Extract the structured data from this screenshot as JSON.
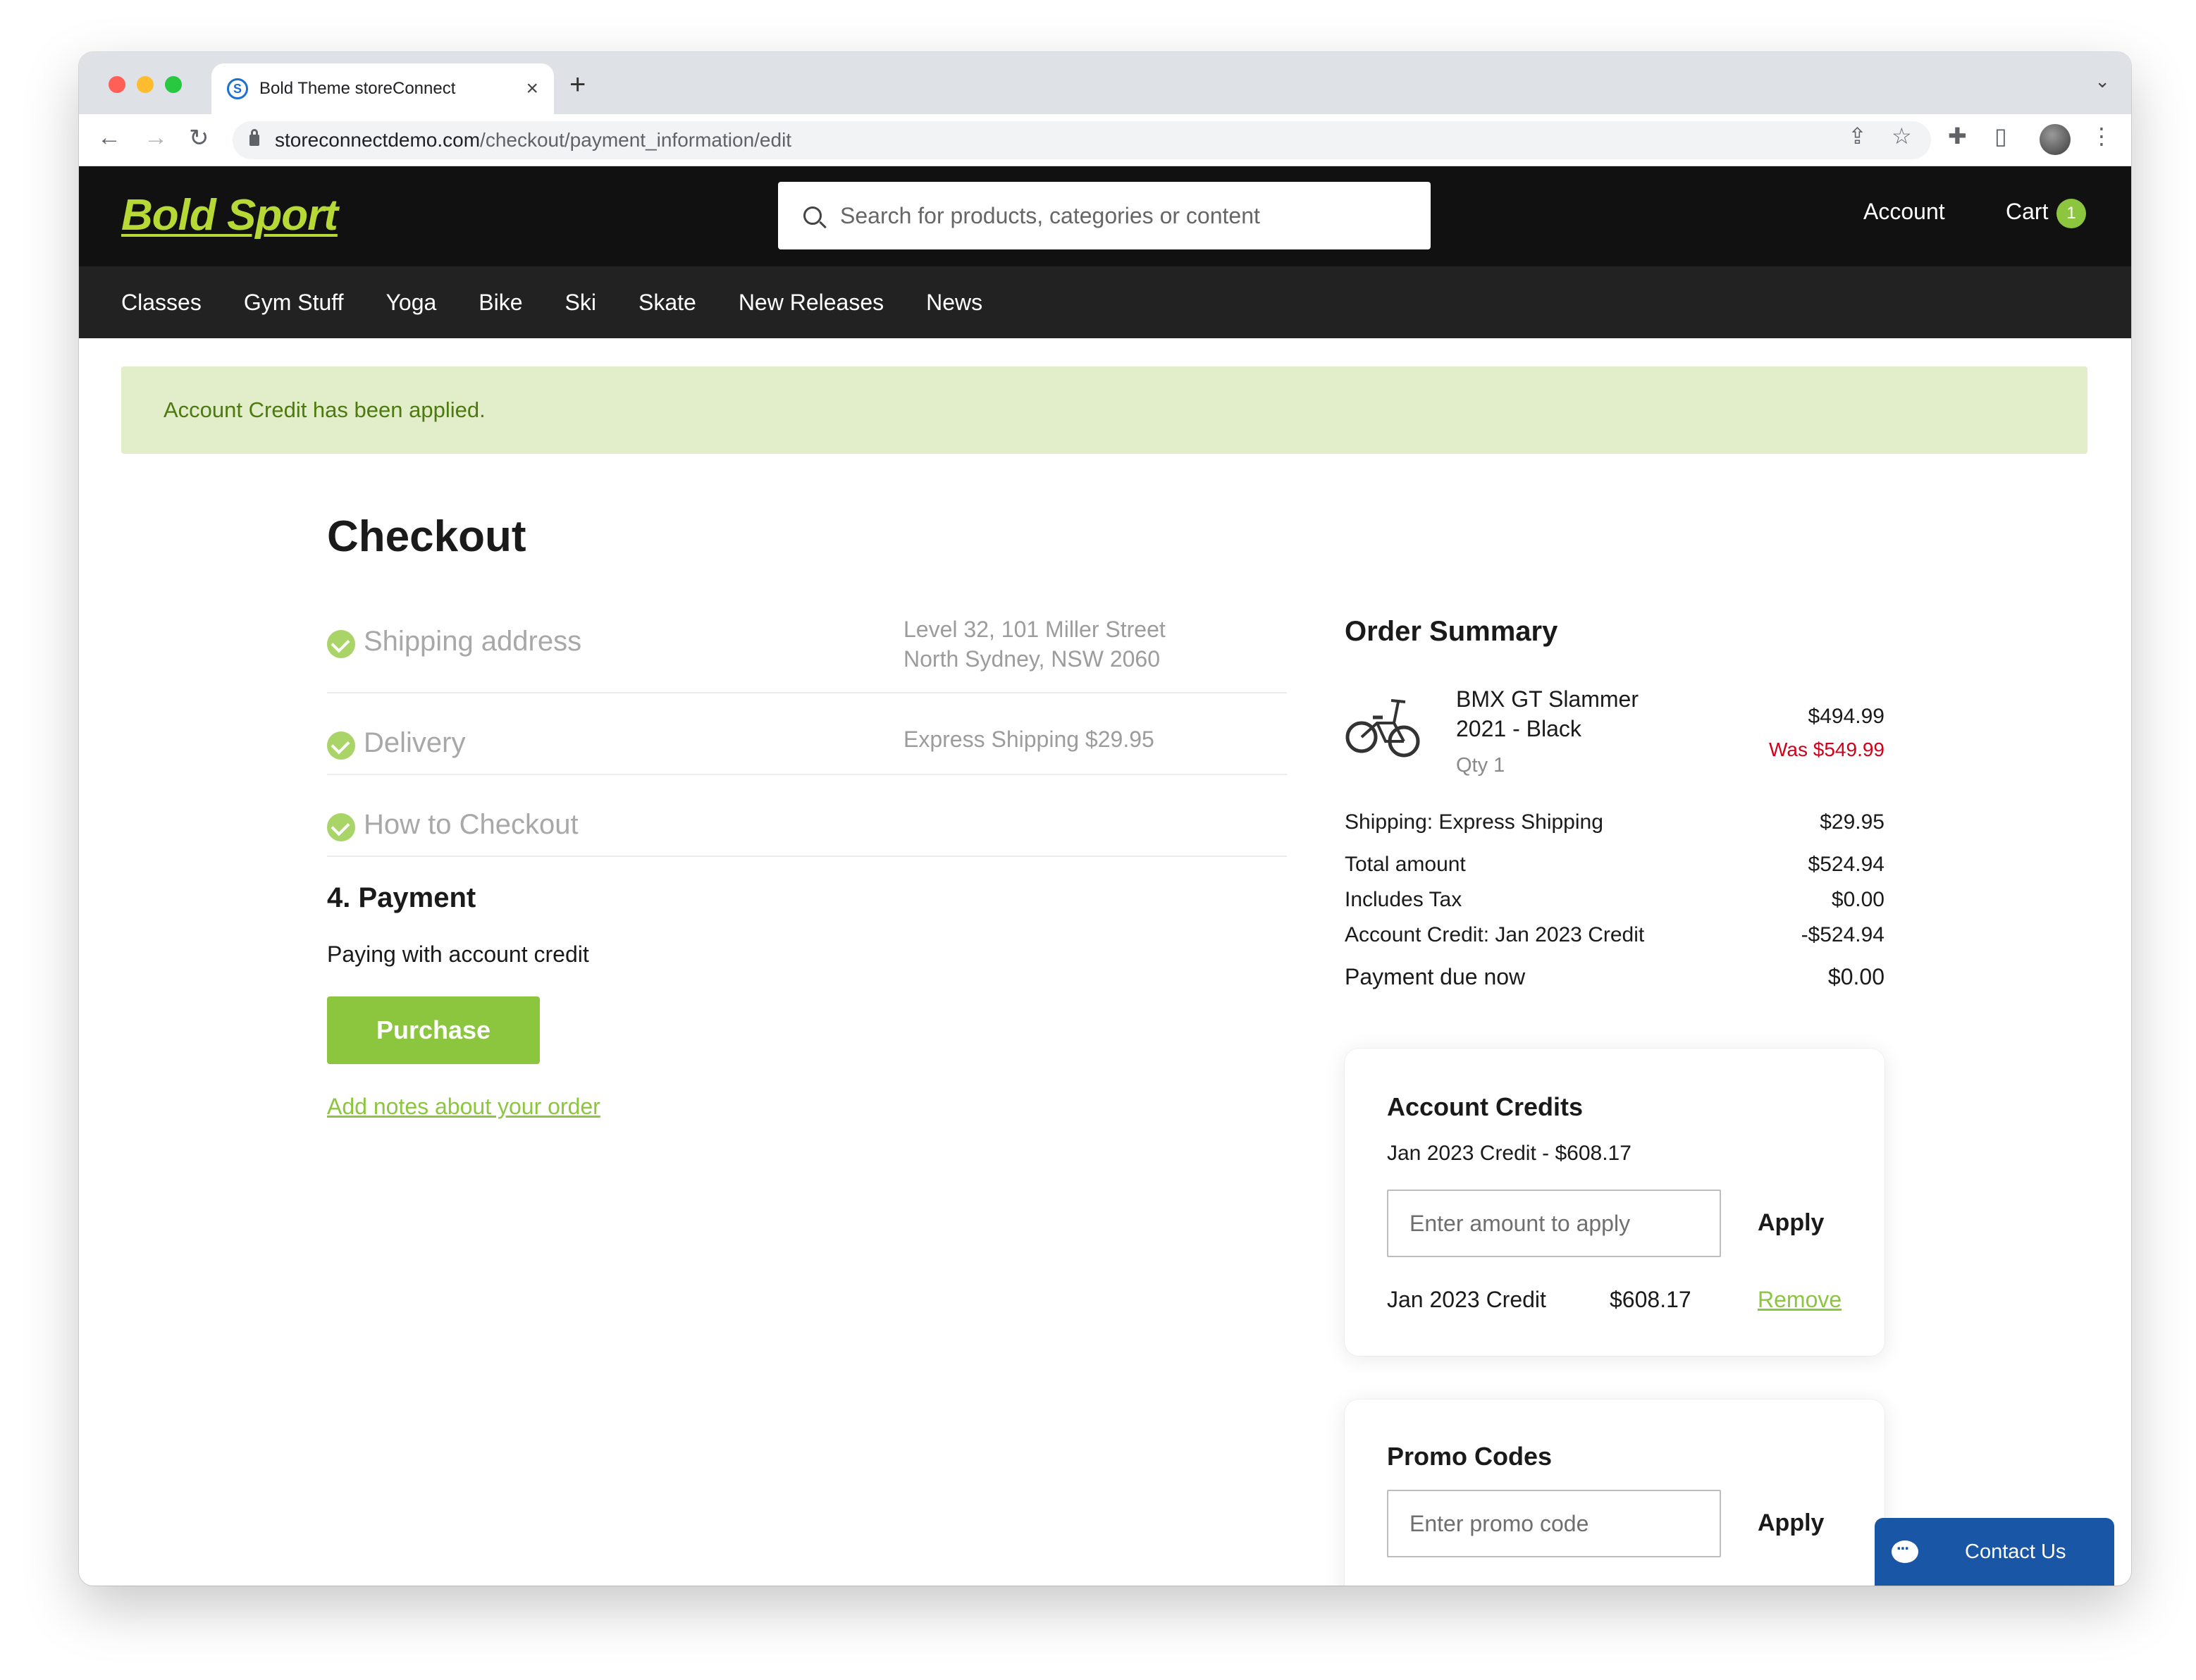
{
  "browser": {
    "tab_title": "Bold Theme storeConnect",
    "tab_close": "×",
    "new_tab": "+",
    "tab_menu": "⌄",
    "url_host": "storeconnectdemo.com",
    "url_path": "/checkout/payment_information/edit"
  },
  "site": {
    "logo": "Bold Sport",
    "search_placeholder": "Search for products, categories or content",
    "account_label": "Account",
    "cart_label": "Cart",
    "cart_count": "1",
    "nav": [
      "Classes",
      "Gym Stuff",
      "Yoga",
      "Bike",
      "Ski",
      "Skate",
      "New Releases",
      "News"
    ]
  },
  "alert": "Account Credit has been applied.",
  "checkout": {
    "title": "Checkout",
    "steps": [
      {
        "label": "Shipping address",
        "detail_line1": "Level 32, 101 Miller Street",
        "detail_line2": "North Sydney, NSW 2060"
      },
      {
        "label": "Delivery",
        "detail_line1": "Express Shipping $29.95"
      },
      {
        "label": "How to Checkout"
      }
    ],
    "payment_heading": "4. Payment",
    "payment_method": "Paying with account credit",
    "purchase_button": "Purchase",
    "notes_link": "Add notes about your order"
  },
  "order_summary": {
    "title": "Order Summary",
    "item": {
      "name_line1": "BMX GT Slammer",
      "name_line2": "2021 - Black",
      "qty": "Qty 1",
      "price": "$494.99",
      "was_price": "Was $549.99"
    },
    "rows": [
      {
        "label": "Shipping: Express Shipping",
        "value": "$29.95"
      },
      {
        "label": "Total amount",
        "value": "$524.94"
      },
      {
        "label": "Includes Tax",
        "value": "$0.00"
      },
      {
        "label": "Account Credit: Jan 2023 Credit",
        "value": "-$524.94"
      },
      {
        "label": "Payment due now",
        "value": "$0.00"
      }
    ]
  },
  "account_credits": {
    "title": "Account Credits",
    "available": "Jan 2023 Credit - $608.17",
    "input_placeholder": "Enter amount to apply",
    "apply_label": "Apply",
    "applied_name": "Jan 2023 Credit",
    "applied_amount": "$608.17",
    "remove_label": "Remove"
  },
  "promo_codes": {
    "title": "Promo Codes",
    "input_placeholder": "Enter promo code",
    "apply_label": "Apply"
  },
  "chat": {
    "label": "Contact Us"
  },
  "colors": {
    "brand_green": "#8cc63f",
    "logo_green": "#b7d936",
    "header_bg": "#111111",
    "alert_bg": "#e2edc9",
    "sale_red": "#d0021b",
    "chat_blue": "#1a56a6"
  }
}
